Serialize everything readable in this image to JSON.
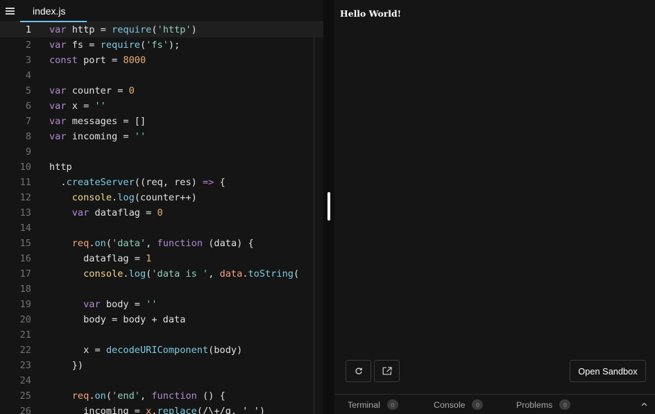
{
  "editor": {
    "active_file": "index.js",
    "lines": [
      {
        "n": "1",
        "tokens": [
          [
            "kw",
            "var"
          ],
          [
            "pl",
            " http = "
          ],
          [
            "fn",
            "require"
          ],
          [
            "pl",
            "("
          ],
          [
            "str",
            "'http'"
          ],
          [
            "pl",
            ")"
          ]
        ]
      },
      {
        "n": "2",
        "tokens": [
          [
            "kw",
            "var"
          ],
          [
            "pl",
            " fs = "
          ],
          [
            "fn",
            "require"
          ],
          [
            "pl",
            "("
          ],
          [
            "str",
            "'fs'"
          ],
          [
            "pl",
            ");"
          ]
        ]
      },
      {
        "n": "3",
        "tokens": [
          [
            "kw",
            "const"
          ],
          [
            "pl",
            " port = "
          ],
          [
            "num",
            "8000"
          ]
        ]
      },
      {
        "n": "4",
        "tokens": []
      },
      {
        "n": "5",
        "tokens": [
          [
            "kw",
            "var"
          ],
          [
            "pl",
            " counter = "
          ],
          [
            "num",
            "0"
          ]
        ]
      },
      {
        "n": "6",
        "tokens": [
          [
            "kw",
            "var"
          ],
          [
            "pl",
            " x = "
          ],
          [
            "str",
            "''"
          ]
        ]
      },
      {
        "n": "7",
        "tokens": [
          [
            "kw",
            "var"
          ],
          [
            "pl",
            " messages = []"
          ]
        ]
      },
      {
        "n": "8",
        "tokens": [
          [
            "kw",
            "var"
          ],
          [
            "pl",
            " incoming = "
          ],
          [
            "str",
            "''"
          ]
        ]
      },
      {
        "n": "9",
        "tokens": []
      },
      {
        "n": "10",
        "tokens": [
          [
            "pl",
            "http"
          ]
        ]
      },
      {
        "n": "11",
        "tokens": [
          [
            "pl",
            "  ."
          ],
          [
            "fn",
            "createServer"
          ],
          [
            "pl",
            "((req, res) "
          ],
          [
            "kw",
            "=>"
          ],
          [
            "pl",
            " {"
          ]
        ]
      },
      {
        "n": "12",
        "tokens": [
          [
            "pl",
            "    "
          ],
          [
            "con",
            "console"
          ],
          [
            "pl",
            "."
          ],
          [
            "fn",
            "log"
          ],
          [
            "pl",
            "(counter++)"
          ]
        ]
      },
      {
        "n": "13",
        "tokens": [
          [
            "pl",
            "    "
          ],
          [
            "kw",
            "var"
          ],
          [
            "pl",
            " dataflag = "
          ],
          [
            "num",
            "0"
          ]
        ]
      },
      {
        "n": "14",
        "tokens": []
      },
      {
        "n": "15",
        "tokens": [
          [
            "pl",
            "    "
          ],
          [
            "var",
            "req"
          ],
          [
            "pl",
            "."
          ],
          [
            "fn",
            "on"
          ],
          [
            "pl",
            "("
          ],
          [
            "str",
            "'data'"
          ],
          [
            "pl",
            ", "
          ],
          [
            "kw",
            "function"
          ],
          [
            "pl",
            " (data) {"
          ]
        ]
      },
      {
        "n": "16",
        "tokens": [
          [
            "pl",
            "      dataflag = "
          ],
          [
            "num",
            "1"
          ]
        ]
      },
      {
        "n": "17",
        "tokens": [
          [
            "pl",
            "      "
          ],
          [
            "con",
            "console"
          ],
          [
            "pl",
            "."
          ],
          [
            "fn",
            "log"
          ],
          [
            "pl",
            "("
          ],
          [
            "str",
            "'data is '"
          ],
          [
            "pl",
            ", "
          ],
          [
            "var",
            "data"
          ],
          [
            "pl",
            "."
          ],
          [
            "fn",
            "toString"
          ],
          [
            "pl",
            "("
          ]
        ]
      },
      {
        "n": "18",
        "tokens": []
      },
      {
        "n": "19",
        "tokens": [
          [
            "pl",
            "      "
          ],
          [
            "kw",
            "var"
          ],
          [
            "pl",
            " body = "
          ],
          [
            "str",
            "''"
          ]
        ]
      },
      {
        "n": "20",
        "tokens": [
          [
            "pl",
            "      body = body + data"
          ]
        ]
      },
      {
        "n": "21",
        "tokens": []
      },
      {
        "n": "22",
        "tokens": [
          [
            "pl",
            "      x = "
          ],
          [
            "fn",
            "decodeURIComponent"
          ],
          [
            "pl",
            "(body)"
          ]
        ]
      },
      {
        "n": "23",
        "tokens": [
          [
            "pl",
            "    })"
          ]
        ]
      },
      {
        "n": "24",
        "tokens": []
      },
      {
        "n": "25",
        "tokens": [
          [
            "pl",
            "    "
          ],
          [
            "var",
            "req"
          ],
          [
            "pl",
            "."
          ],
          [
            "fn",
            "on"
          ],
          [
            "pl",
            "("
          ],
          [
            "str",
            "'end'"
          ],
          [
            "pl",
            ", "
          ],
          [
            "kw",
            "function"
          ],
          [
            "pl",
            " () {"
          ]
        ]
      },
      {
        "n": "26",
        "tokens": [
          [
            "pl",
            "      incoming = "
          ],
          [
            "var",
            "x"
          ],
          [
            "pl",
            "."
          ],
          [
            "fn",
            "replace"
          ],
          [
            "pl",
            "(/\\+/g, ' ')"
          ]
        ]
      }
    ]
  },
  "preview": {
    "output_text": "Hello World!",
    "open_sandbox_label": "Open Sandbox",
    "refresh_icon": "refresh-icon",
    "open_window_icon": "external-link-icon"
  },
  "devtools": {
    "tabs": [
      {
        "label": "Terminal",
        "count": "0"
      },
      {
        "label": "Console",
        "count": "0"
      },
      {
        "label": "Problems",
        "count": "0"
      }
    ]
  },
  "colors": {
    "background": "#151515",
    "keyword": "#b48ad1",
    "string": "#8fd0bd",
    "function": "#7ccbe1",
    "number": "#e9b07b",
    "tab_underline": "#6cc7f6"
  }
}
